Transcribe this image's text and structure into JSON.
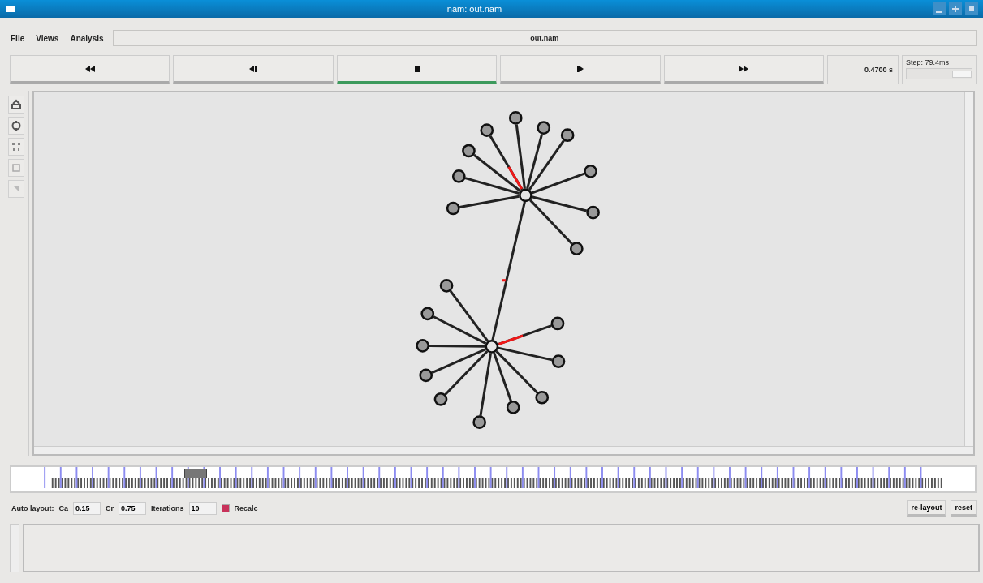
{
  "window": {
    "title": "nam: out.nam"
  },
  "menu": [
    "File",
    "Views",
    "Analysis"
  ],
  "file_label": "out.nam",
  "transport": [
    {
      "kind": "rewind",
      "selected": false
    },
    {
      "kind": "back",
      "selected": false
    },
    {
      "kind": "stop",
      "selected": true
    },
    {
      "kind": "play",
      "selected": false
    },
    {
      "kind": "forward",
      "selected": false
    }
  ],
  "time": "0.4700 s",
  "step": {
    "label": "Step: 79.4ms",
    "level": 0.85
  },
  "network": {
    "trunk": {
      "transmitting": true
    },
    "hubs": [
      {
        "leaves": [
          {
            "transmitting": true
          },
          {
            "transmitting": false
          },
          {
            "transmitting": false
          },
          {
            "transmitting": false
          },
          {
            "transmitting": false
          },
          {
            "transmitting": false
          },
          {
            "transmitting": false
          },
          {
            "transmitting": false
          },
          {
            "transmitting": false
          },
          {
            "transmitting": false
          }
        ]
      },
      {
        "leaves": [
          {
            "transmitting": false
          },
          {
            "transmitting": false
          },
          {
            "transmitting": false
          },
          {
            "transmitting": false
          },
          {
            "transmitting": false
          },
          {
            "transmitting": false
          },
          {
            "transmitting": false
          },
          {
            "transmitting": false
          },
          {
            "transmitting": false
          },
          {
            "transmitting": true
          }
        ]
      }
    ]
  },
  "timeline": {
    "level": 0.19
  },
  "layout": {
    "title": "Auto layout:",
    "fields": [
      {
        "label": "Ca",
        "value": "0.15"
      },
      {
        "label": "Cr",
        "value": "0.75"
      },
      {
        "label": "Iterations",
        "value": "10"
      }
    ],
    "recalc": {
      "label": "Recalc",
      "checked": true
    }
  },
  "buttons": [
    "re-layout",
    "reset"
  ]
}
